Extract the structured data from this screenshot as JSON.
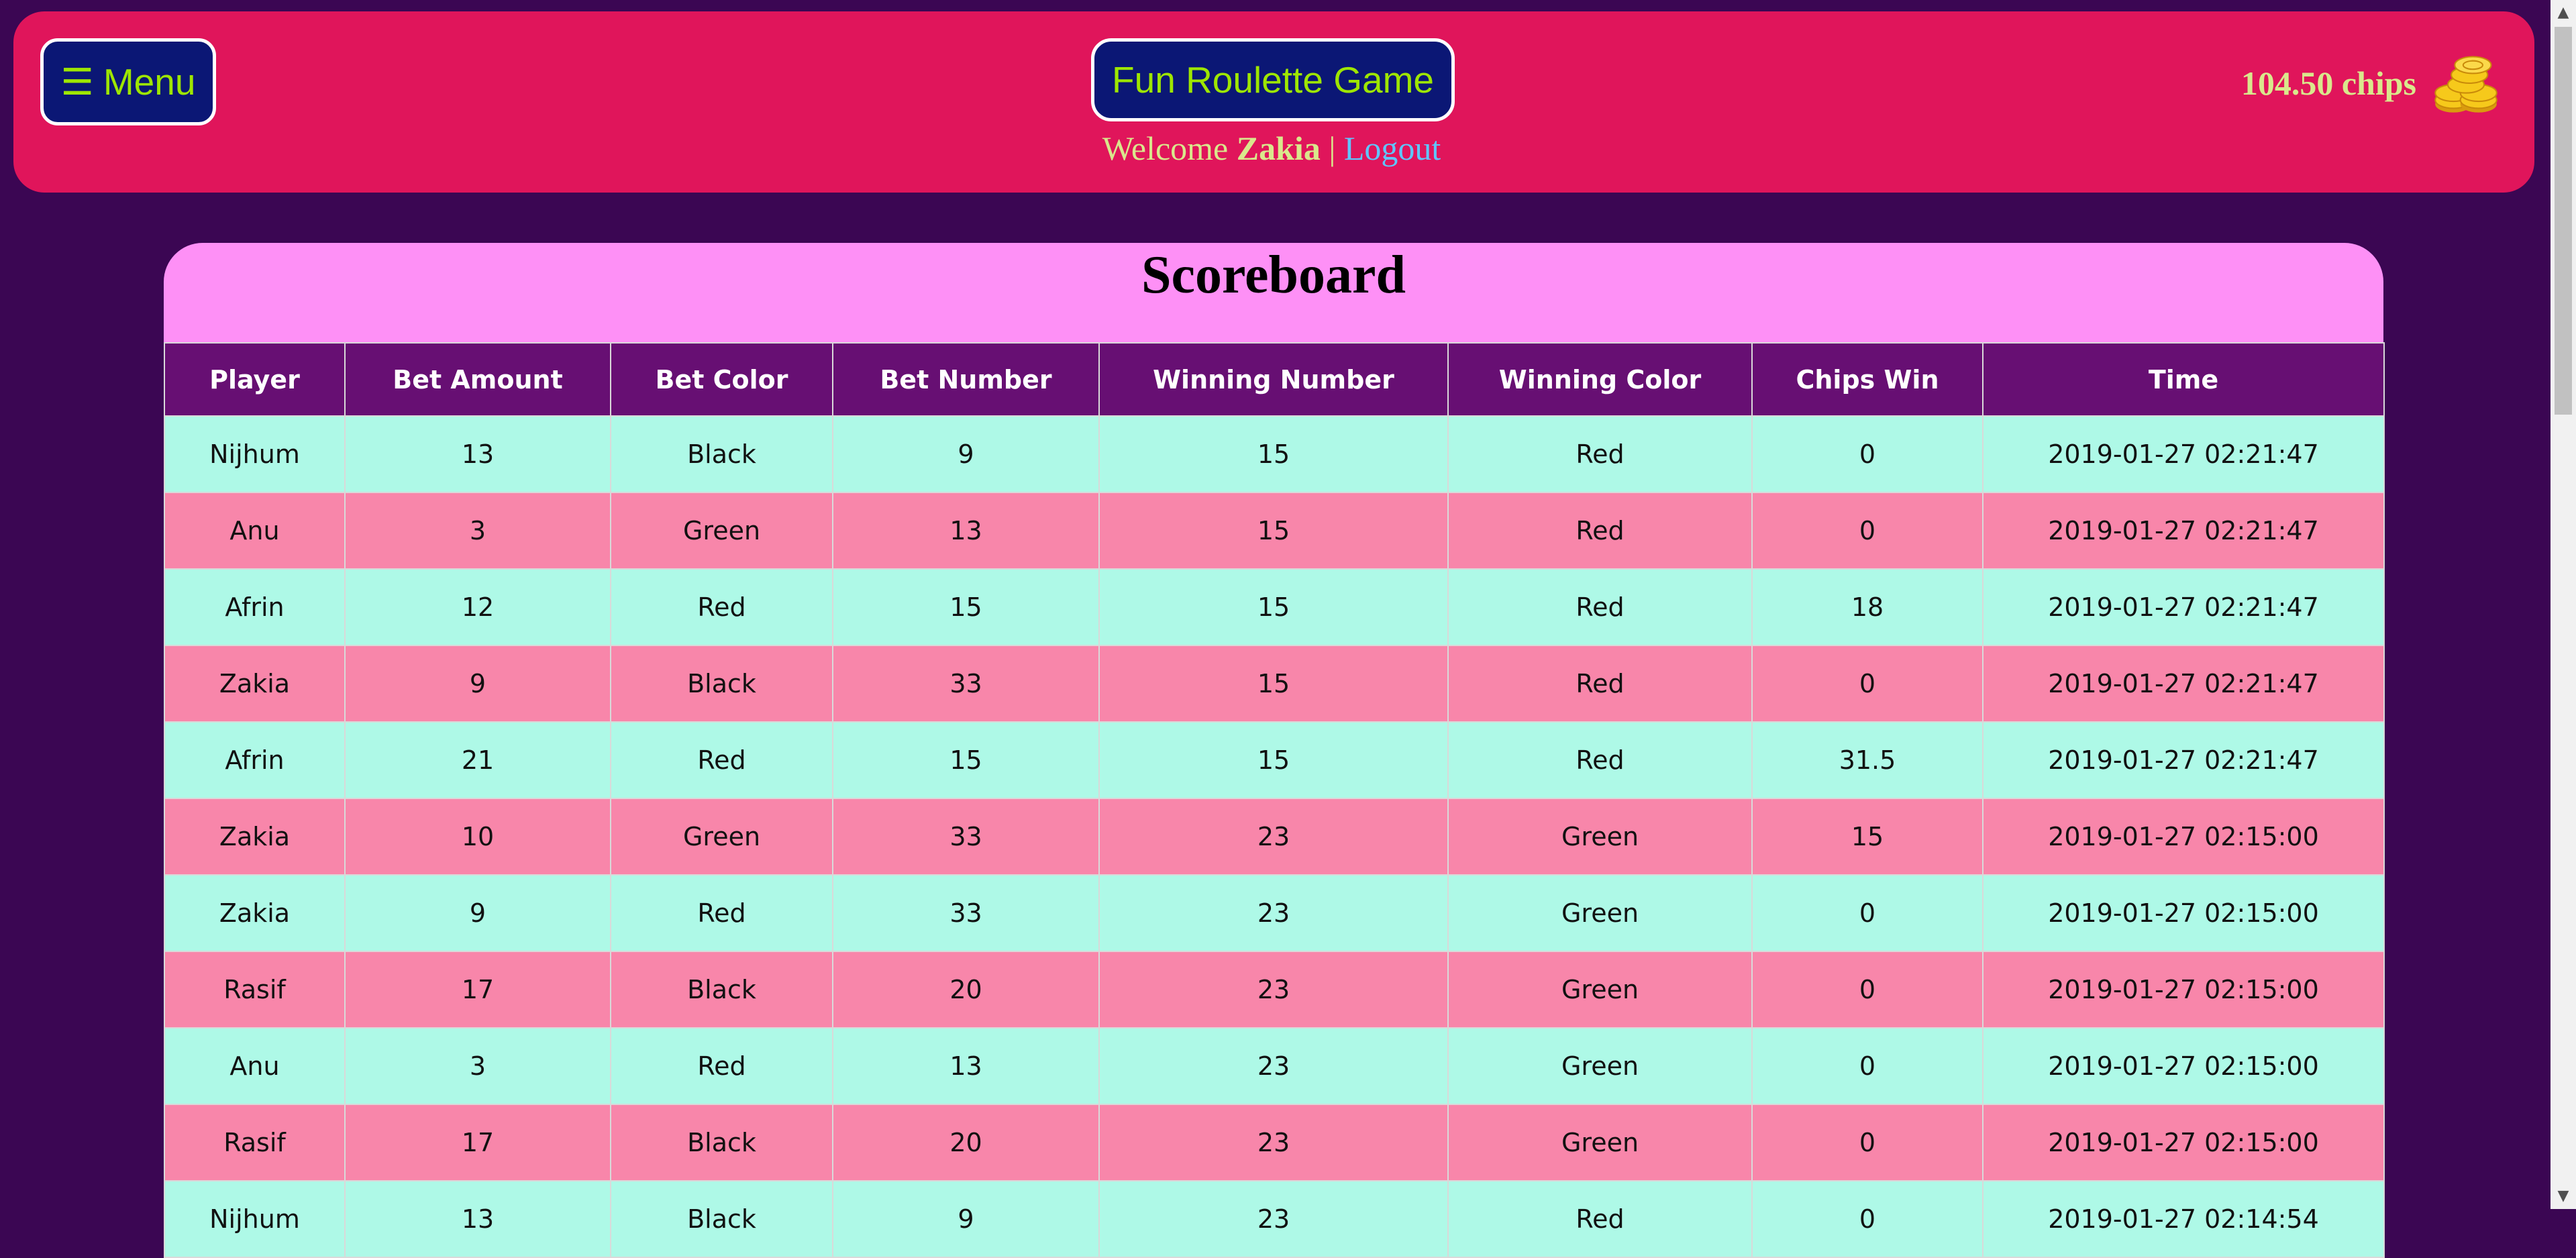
{
  "header": {
    "menu_icon": "☰",
    "menu_label": "Menu",
    "title": "Fun Roulette Game",
    "welcome_text": "Welcome",
    "username": "Zakia",
    "separator": "|",
    "logout_label": "Logout",
    "chips_text": "104.50 chips",
    "chips_icon": "coins-icon"
  },
  "scoreboard": {
    "title": "Scoreboard",
    "columns": [
      "Player",
      "Bet Amount",
      "Bet Color",
      "Bet Number",
      "Winning Number",
      "Winning Color",
      "Chips Win",
      "Time"
    ],
    "rows": [
      [
        "Nijhum",
        "13",
        "Black",
        "9",
        "15",
        "Red",
        "0",
        "2019-01-27 02:21:47"
      ],
      [
        "Anu",
        "3",
        "Green",
        "13",
        "15",
        "Red",
        "0",
        "2019-01-27 02:21:47"
      ],
      [
        "Afrin",
        "12",
        "Red",
        "15",
        "15",
        "Red",
        "18",
        "2019-01-27 02:21:47"
      ],
      [
        "Zakia",
        "9",
        "Black",
        "33",
        "15",
        "Red",
        "0",
        "2019-01-27 02:21:47"
      ],
      [
        "Afrin",
        "21",
        "Red",
        "15",
        "15",
        "Red",
        "31.5",
        "2019-01-27 02:21:47"
      ],
      [
        "Zakia",
        "10",
        "Green",
        "33",
        "23",
        "Green",
        "15",
        "2019-01-27 02:15:00"
      ],
      [
        "Zakia",
        "9",
        "Red",
        "33",
        "23",
        "Green",
        "0",
        "2019-01-27 02:15:00"
      ],
      [
        "Rasif",
        "17",
        "Black",
        "20",
        "23",
        "Green",
        "0",
        "2019-01-27 02:15:00"
      ],
      [
        "Anu",
        "3",
        "Red",
        "13",
        "23",
        "Green",
        "0",
        "2019-01-27 02:15:00"
      ],
      [
        "Rasif",
        "17",
        "Black",
        "20",
        "23",
        "Green",
        "0",
        "2019-01-27 02:15:00"
      ],
      [
        "Nijhum",
        "13",
        "Black",
        "9",
        "23",
        "Red",
        "0",
        "2019-01-27 02:14:54"
      ]
    ]
  },
  "colors": {
    "background": "#3b0653",
    "header": "#e0155b",
    "button": "#0b1775",
    "button_text": "#9ee600",
    "table_header": "#670f73",
    "row_odd": "#aef9e7",
    "row_even": "#f886aa",
    "title_band": "#fe90f6"
  }
}
